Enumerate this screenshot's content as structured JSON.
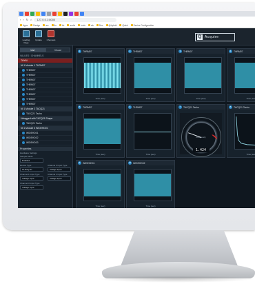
{
  "browser": {
    "url": "127.0.0.1:8000",
    "bookmarks": [
      "Apps",
      "Design",
      "arc",
      "fin",
      "tfc",
      "audio",
      "tools",
      "wk",
      "Dev",
      "@hybrid",
      "Quick",
      "Device Configuration"
    ]
  },
  "toolbar": {
    "buttons": [
      {
        "label": "Loading Page"
      },
      {
        "label": "Update"
      },
      {
        "label": "Channels"
      }
    ],
    "logo_text": "Acquire"
  },
  "sidebar": {
    "tabs": [
      {
        "label": "List",
        "active": true
      },
      {
        "label": "Visual",
        "active": false
      }
    ],
    "section_title": "VALUES / CHANNELS",
    "search_placeholder": "",
    "tree": [
      {
        "label": "THYM",
        "kind": "sel"
      },
      {
        "label": "NI 1 Module 1 THRM07",
        "kind": "head"
      },
      {
        "label": "THRM07",
        "kind": "child"
      },
      {
        "label": "THRM07",
        "kind": "child"
      },
      {
        "label": "THRM07",
        "kind": "child"
      },
      {
        "label": "THRM07",
        "kind": "child"
      },
      {
        "label": "THRM07",
        "kind": "child"
      },
      {
        "label": "THRM07",
        "kind": "child"
      },
      {
        "label": "THRM07",
        "kind": "child"
      },
      {
        "label": "THRM07",
        "kind": "child"
      },
      {
        "label": "NI 1 Module 2 TACQ21",
        "kind": "head"
      },
      {
        "label": "TACQ21 Tacho",
        "kind": "child"
      },
      {
        "label": "Untagged with TACQ21 Shape",
        "kind": "head"
      },
      {
        "label": "TACQ21 Tacho",
        "kind": "child"
      },
      {
        "label": "NI 1 Module 3 WIDEHD01",
        "kind": "head"
      },
      {
        "label": "WIDEHD01",
        "kind": "child"
      },
      {
        "label": "WIDEHD02",
        "kind": "child"
      },
      {
        "label": "WIDEHD03",
        "kind": "child"
      }
    ],
    "properties": {
      "title": "Properties",
      "group": "Hardware Settings",
      "sample_mode_label": "Sample Mode",
      "sample_mode_value": "Enabled",
      "fields": [
        {
          "label": "Device Type",
          "value": "NI-DAQ 9x"
        },
        {
          "label": "Channel 0 Input Type",
          "value": "Voltage Input"
        },
        {
          "label": "Channel 1 Input Type",
          "value": "Voltage Input"
        },
        {
          "label": "Channel 2 Input Type",
          "value": "Voltage Input"
        },
        {
          "label": "Channel 3 Input Type",
          "value": "Voltage Input"
        }
      ]
    }
  },
  "panels": [
    {
      "num": "1",
      "title": "THRM07",
      "signal": "noise",
      "xlabel": "Time (sec)"
    },
    {
      "num": "2",
      "title": "THRM07",
      "signal": "flat",
      "xlabel": "Time (sec)"
    },
    {
      "num": "3",
      "title": "THRM07",
      "signal": "flat",
      "xlabel": "Time (sec)"
    },
    {
      "num": "4",
      "title": "THRM07",
      "signal": "flat",
      "xlabel": "Time (sec)"
    },
    {
      "num": "5",
      "title": "THRM07",
      "signal": "flat",
      "xlabel": "Time (sec)"
    },
    {
      "num": "6",
      "title": "THRM07",
      "signal": "line",
      "xlabel": "Time (sec)"
    },
    {
      "num": "7",
      "title": "TACQ21 Tacho",
      "signal": "gauge",
      "gauge_label": "Frequency",
      "gauge_value": "1.424"
    },
    {
      "num": "8",
      "title": "TACQ21 Tacho",
      "signal": "decay",
      "xlabel": "Time (sec)"
    },
    {
      "num": "9",
      "title": "WIDEHD01",
      "signal": "flat",
      "xlabel": "Time (sec)"
    },
    {
      "num": "10",
      "title": "WIDEHD02",
      "signal": "flat",
      "xlabel": "Time (sec)"
    }
  ],
  "colors": {
    "accent": "#2a88c6",
    "signal": "#2f8fa6",
    "selection": "#7a1f1f",
    "background": "#0f171f"
  }
}
